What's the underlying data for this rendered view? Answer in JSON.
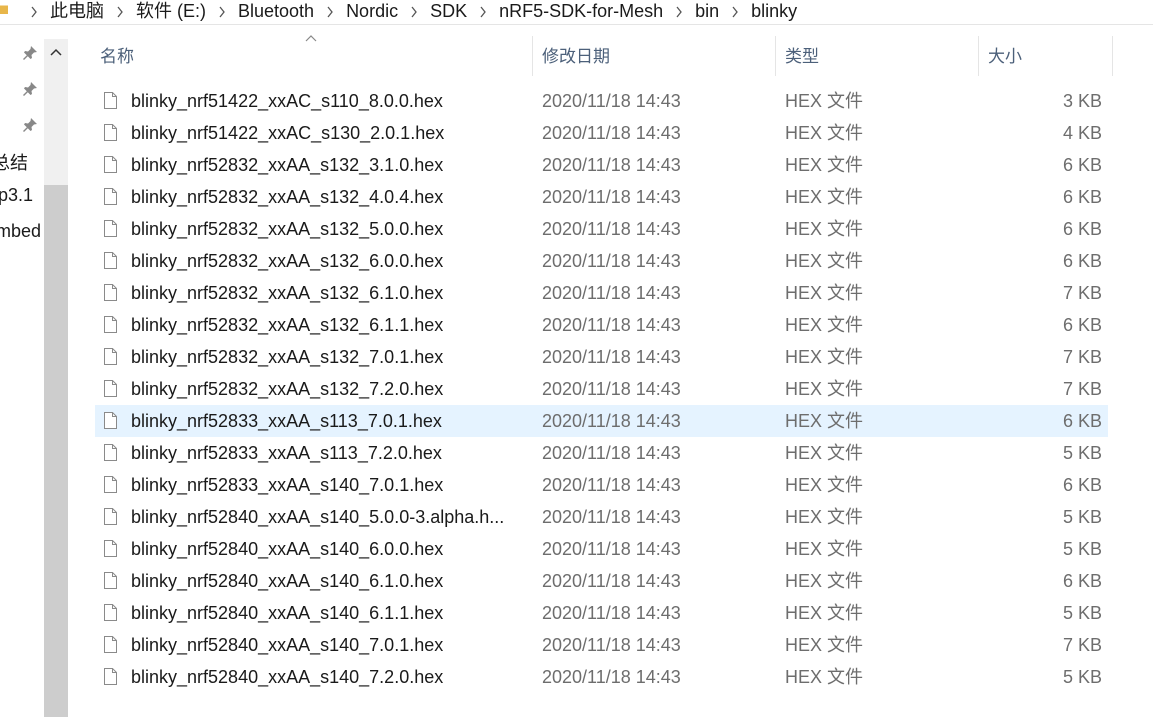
{
  "address": {
    "crumbs": [
      "此电脑",
      "软件 (E:)",
      "Bluetooth",
      "Nordic",
      "SDK",
      "nRF5-SDK-for-Mesh",
      "bin",
      "blinky"
    ]
  },
  "nav": {
    "items": [
      "总结",
      "p3.1",
      "mbed"
    ]
  },
  "columns": {
    "name": "名称",
    "date": "修改日期",
    "type": "类型",
    "size": "大小"
  },
  "files": [
    {
      "name": "blinky_nrf51422_xxAC_s110_8.0.0.hex",
      "date": "2020/11/18 14:43",
      "type": "HEX 文件",
      "size": "3 KB"
    },
    {
      "name": "blinky_nrf51422_xxAC_s130_2.0.1.hex",
      "date": "2020/11/18 14:43",
      "type": "HEX 文件",
      "size": "4 KB"
    },
    {
      "name": "blinky_nrf52832_xxAA_s132_3.1.0.hex",
      "date": "2020/11/18 14:43",
      "type": "HEX 文件",
      "size": "6 KB"
    },
    {
      "name": "blinky_nrf52832_xxAA_s132_4.0.4.hex",
      "date": "2020/11/18 14:43",
      "type": "HEX 文件",
      "size": "6 KB"
    },
    {
      "name": "blinky_nrf52832_xxAA_s132_5.0.0.hex",
      "date": "2020/11/18 14:43",
      "type": "HEX 文件",
      "size": "6 KB"
    },
    {
      "name": "blinky_nrf52832_xxAA_s132_6.0.0.hex",
      "date": "2020/11/18 14:43",
      "type": "HEX 文件",
      "size": "6 KB"
    },
    {
      "name": "blinky_nrf52832_xxAA_s132_6.1.0.hex",
      "date": "2020/11/18 14:43",
      "type": "HEX 文件",
      "size": "7 KB"
    },
    {
      "name": "blinky_nrf52832_xxAA_s132_6.1.1.hex",
      "date": "2020/11/18 14:43",
      "type": "HEX 文件",
      "size": "6 KB"
    },
    {
      "name": "blinky_nrf52832_xxAA_s132_7.0.1.hex",
      "date": "2020/11/18 14:43",
      "type": "HEX 文件",
      "size": "7 KB"
    },
    {
      "name": "blinky_nrf52832_xxAA_s132_7.2.0.hex",
      "date": "2020/11/18 14:43",
      "type": "HEX 文件",
      "size": "7 KB"
    },
    {
      "name": "blinky_nrf52833_xxAA_s113_7.0.1.hex",
      "date": "2020/11/18 14:43",
      "type": "HEX 文件",
      "size": "6 KB",
      "selected": true
    },
    {
      "name": "blinky_nrf52833_xxAA_s113_7.2.0.hex",
      "date": "2020/11/18 14:43",
      "type": "HEX 文件",
      "size": "5 KB"
    },
    {
      "name": "blinky_nrf52833_xxAA_s140_7.0.1.hex",
      "date": "2020/11/18 14:43",
      "type": "HEX 文件",
      "size": "6 KB"
    },
    {
      "name": "blinky_nrf52840_xxAA_s140_5.0.0-3.alpha.h...",
      "date": "2020/11/18 14:43",
      "type": "HEX 文件",
      "size": "5 KB"
    },
    {
      "name": "blinky_nrf52840_xxAA_s140_6.0.0.hex",
      "date": "2020/11/18 14:43",
      "type": "HEX 文件",
      "size": "5 KB"
    },
    {
      "name": "blinky_nrf52840_xxAA_s140_6.1.0.hex",
      "date": "2020/11/18 14:43",
      "type": "HEX 文件",
      "size": "6 KB"
    },
    {
      "name": "blinky_nrf52840_xxAA_s140_6.1.1.hex",
      "date": "2020/11/18 14:43",
      "type": "HEX 文件",
      "size": "5 KB"
    },
    {
      "name": "blinky_nrf52840_xxAA_s140_7.0.1.hex",
      "date": "2020/11/18 14:43",
      "type": "HEX 文件",
      "size": "7 KB"
    },
    {
      "name": "blinky_nrf52840_xxAA_s140_7.2.0.hex",
      "date": "2020/11/18 14:43",
      "type": "HEX 文件",
      "size": "5 KB"
    }
  ],
  "icons": {
    "folder": "folder-icon",
    "pin": "pin-icon",
    "file": "file-icon",
    "sort": "sort-ascending-icon"
  },
  "colors": {
    "selection": "#e5f3ff",
    "header_text": "#4c607a",
    "detail_text": "#6d6d6d"
  }
}
